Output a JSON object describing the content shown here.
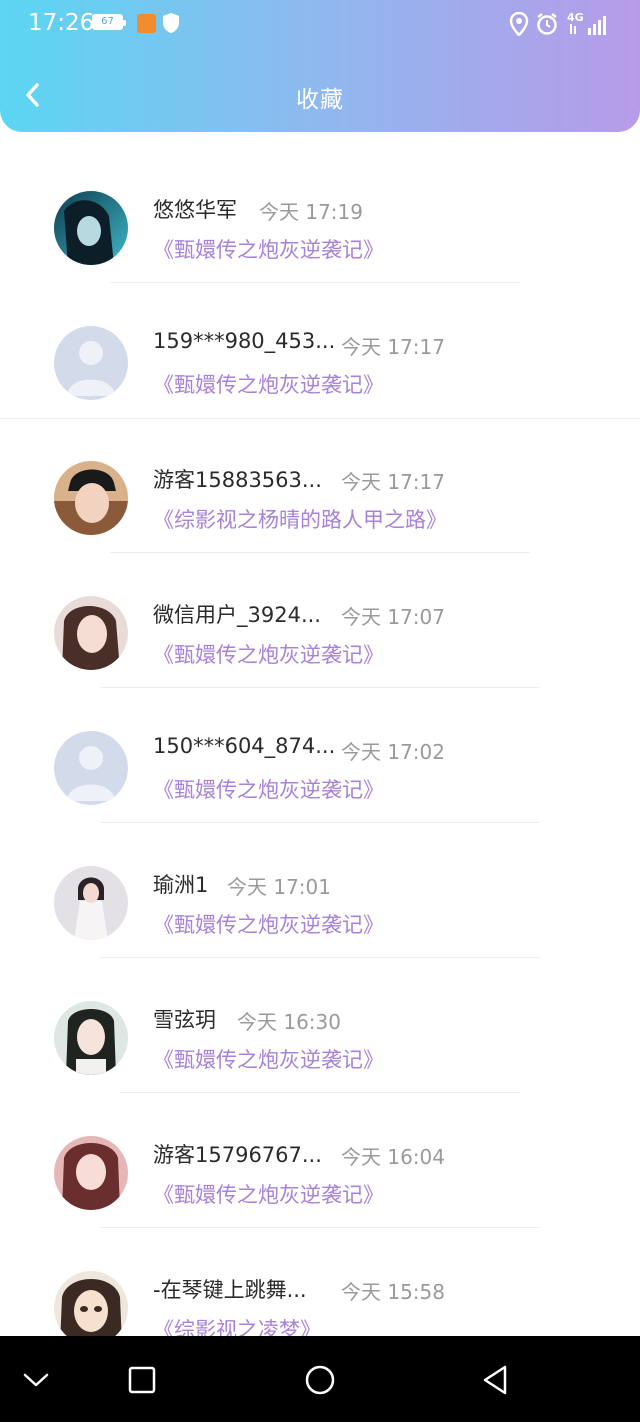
{
  "status_bar": {
    "time": "17:26",
    "battery": "67",
    "network": "4G"
  },
  "header": {
    "title": "收藏"
  },
  "items": [
    {
      "name": "悠悠华军",
      "time": "今天 17:19",
      "book": "《甄嬛传之炮灰逆袭记》",
      "avatar": "photo-avatar"
    },
    {
      "name": "159***980_453...",
      "time": "今天 17:17",
      "book": "《甄嬛传之炮灰逆袭记》",
      "avatar": "default-avatar"
    },
    {
      "name": "游客15883563...",
      "time": "今天 17:17",
      "book": "《综影视之杨晴的路人甲之路》",
      "avatar": "photo-avatar"
    },
    {
      "name": "微信用户_3924...",
      "time": "今天 17:07",
      "book": "《甄嬛传之炮灰逆袭记》",
      "avatar": "photo-avatar"
    },
    {
      "name": "150***604_874...",
      "time": "今天 17:02",
      "book": "《甄嬛传之炮灰逆袭记》",
      "avatar": "default-avatar"
    },
    {
      "name": "瑜洲1",
      "time": "今天 17:01",
      "book": "《甄嬛传之炮灰逆袭记》",
      "avatar": "photo-avatar"
    },
    {
      "name": "雪弦玥",
      "time": "今天 16:30",
      "book": "《甄嬛传之炮灰逆袭记》",
      "avatar": "photo-avatar"
    },
    {
      "name": "游客15796767...",
      "time": "今天 16:04",
      "book": "《甄嬛传之炮灰逆袭记》",
      "avatar": "photo-avatar"
    },
    {
      "name": "-在琴键上跳舞...",
      "time": "今天 15:58",
      "book": "《综影视之凌梦》",
      "avatar": "photo-avatar"
    }
  ],
  "colors": {
    "header_gradient_start": "#5bd6f2",
    "header_gradient_end": "#b79be9",
    "book_title": "#a882d8",
    "time_text": "#9a9a9a"
  },
  "nav_bar": [
    "chevron-down-icon",
    "square-icon",
    "circle-icon",
    "triangle-back-icon"
  ]
}
